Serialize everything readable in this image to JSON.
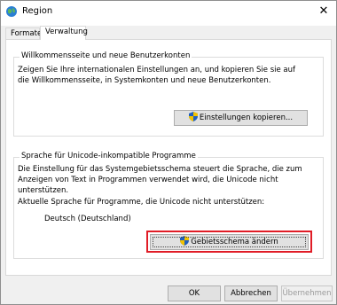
{
  "window": {
    "title": "Region",
    "close_glyph": "✕"
  },
  "tabs": [
    {
      "label": "Formate"
    },
    {
      "label": "Verwaltung",
      "active": true
    }
  ],
  "welcome_group": {
    "legend": "Willkommensseite und neue Benutzerkonten",
    "line1": "Zeigen Sie Ihre internationalen Einstellungen an, und kopieren Sie sie auf",
    "line2": "die Willkommensseite, in Systemkonten und neue Benutzerkonten.",
    "button_label": "Einstellungen kopieren..."
  },
  "unicode_group": {
    "legend": "Sprache für Unicode-inkompatible Programme",
    "line1": "Die Einstellung für das Systemgebietsschema steuert die Sprache, die zum",
    "line2": "Anzeigen von Text in Programmen verwendet wird, die Unicode nicht",
    "line3": "unterstützen.",
    "line4": "Aktuelle Sprache für Programme, die Unicode nicht unterstützen:",
    "current_language": "Deutsch (Deutschland)",
    "button_label": "Gebietsschema ändern"
  },
  "footer": {
    "ok_label": "OK",
    "cancel_label": "Abbrechen",
    "apply_label": "Übernehmen"
  },
  "colors": {
    "highlight": "#e01c26",
    "shield_blue": "#1f5fbf",
    "shield_yellow": "#f2c200"
  }
}
